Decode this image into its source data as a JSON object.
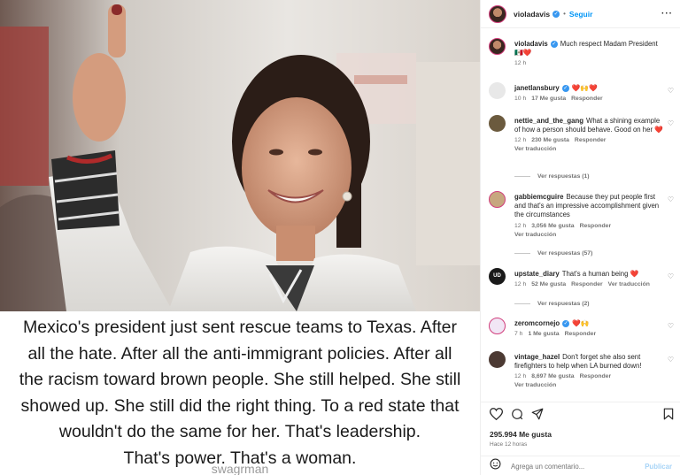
{
  "post": {
    "caption_lines": [
      "Mexico's president just sent rescue teams to Texas. After",
      "all the hate. After all the anti-immigrant policies. After all",
      "the racism toward brown people. She still helped. She still",
      "showed up. She still did the right thing. To a red state that",
      "wouldn't do the same for her. That's leadership.",
      "That's power. That's a woman."
    ],
    "watermark": "swagrman"
  },
  "header": {
    "username": "violadavis",
    "separator": "•",
    "follow_label": "Seguir",
    "more_label": "···"
  },
  "comments": [
    {
      "user": "violadavis",
      "text": "Much respect Madam President 🇲🇽❤️",
      "time": "12 h",
      "likes": "",
      "reply": "",
      "translate": ""
    },
    {
      "user": "janetlansbury",
      "text": "❤️🙌❤️",
      "time": "10 h",
      "likes": "17 Me gusta",
      "reply": "Responder",
      "translate": ""
    },
    {
      "user": "nettie_and_the_gang",
      "text": "What a shining example of how a person should behave. Good on her ❤️",
      "time": "12 h",
      "likes": "230 Me gusta",
      "reply": "Responder",
      "translate": "Ver traducción",
      "replies": "Ver respuestas (1)"
    },
    {
      "user": "gabbiemcguire",
      "text": "Because they put people first and that's an impressive accomplishment given the circumstances",
      "time": "12 h",
      "likes": "3,056 Me gusta",
      "reply": "Responder",
      "translate": "Ver traducción",
      "replies": "Ver respuestas (57)"
    },
    {
      "user": "upstate_diary",
      "text": "That's a human being ❤️",
      "time": "12 h",
      "likes": "52 Me gusta",
      "reply": "Responder",
      "translate": "Ver traducción",
      "replies": "Ver respuestas (2)"
    },
    {
      "user": "zeromcornejo",
      "text": "❤️🙌",
      "time": "7 h",
      "likes": "1 Me gusta",
      "reply": "Responder",
      "translate": ""
    },
    {
      "user": "vintage_hazel",
      "text": "Don't forget she also sent firefighters to help when LA burned down!",
      "time": "12 h",
      "likes": "8,697 Me gusta",
      "reply": "Responder",
      "translate": "Ver traducción"
    }
  ],
  "footer": {
    "likes": "295.994 Me gusta",
    "time": "Hace 12 horas",
    "comment_placeholder": "Agrega un comentario...",
    "publish_label": "Publicar"
  },
  "colors": {
    "accent": "#0095f6",
    "verified": "#3797f0",
    "muted": "#737373",
    "story_ring": "#d13e7c"
  }
}
